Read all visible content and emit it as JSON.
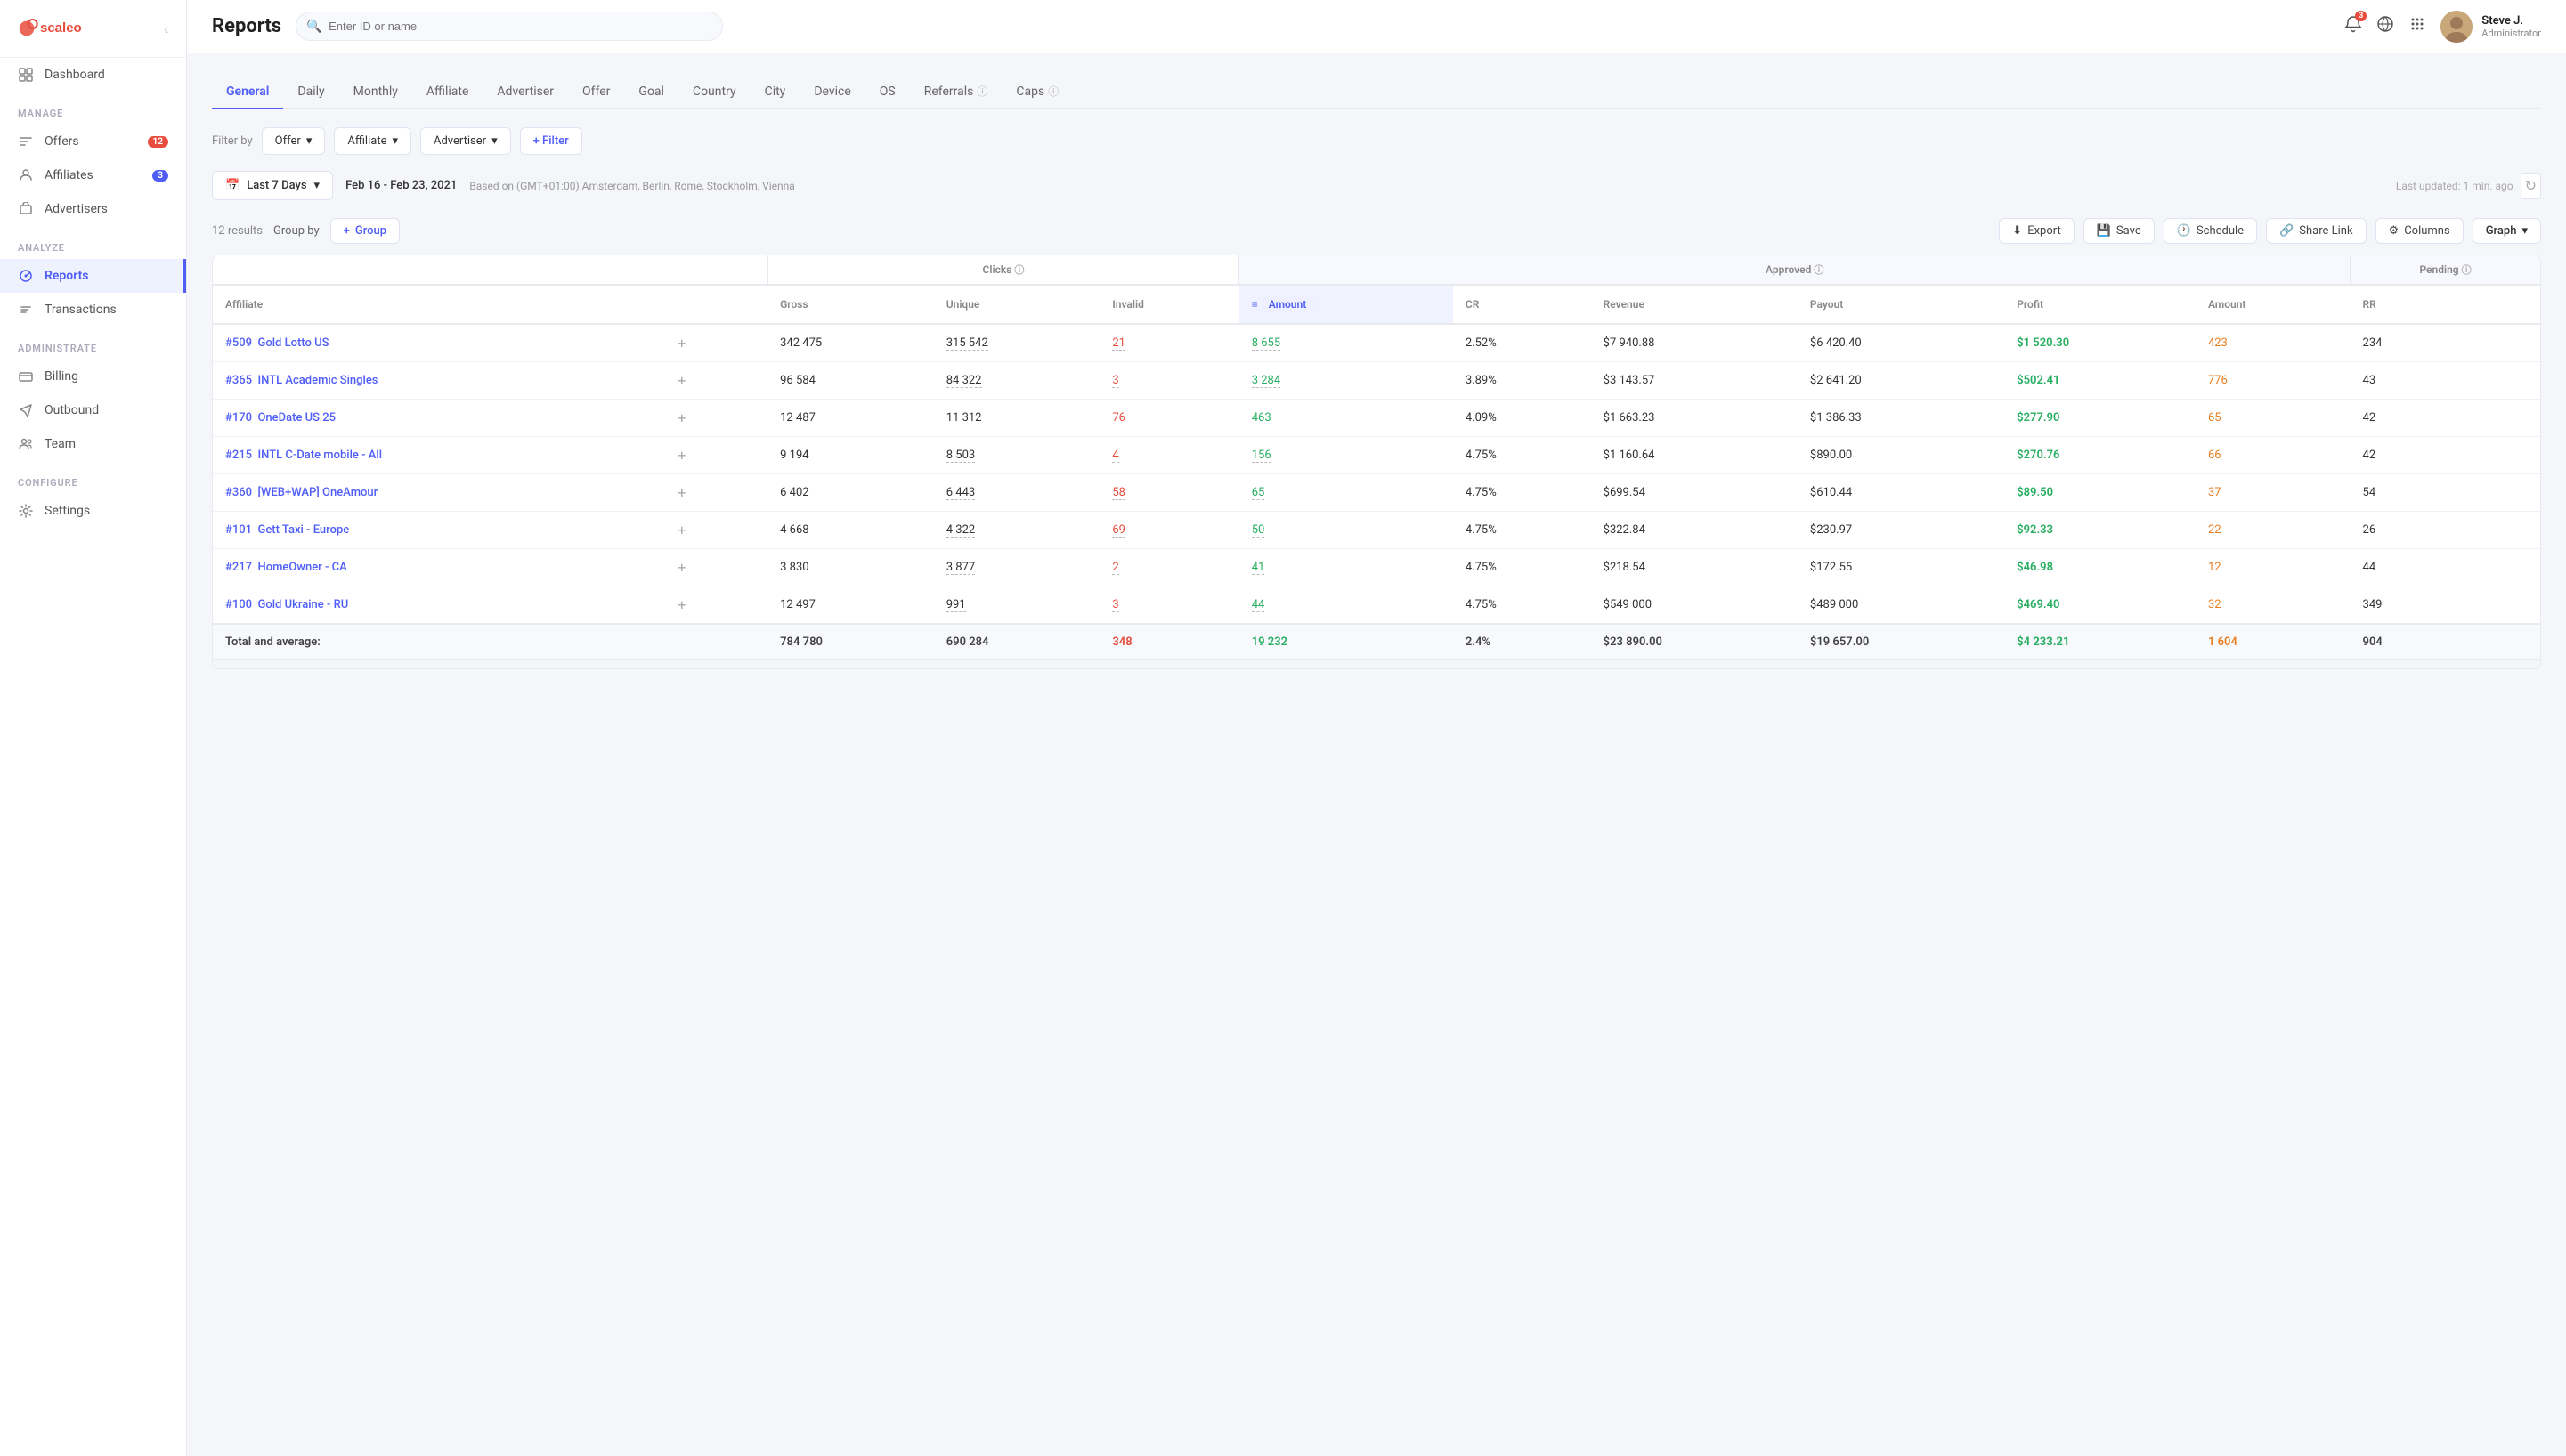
{
  "app": {
    "logo_text": "scaleo"
  },
  "header": {
    "title": "Reports",
    "search_placeholder": "Enter ID or name",
    "user": {
      "name": "Steve J.",
      "role": "Administrator"
    },
    "notifications_count": "3"
  },
  "sidebar": {
    "back_icon": "‹",
    "sections": [
      {
        "label": "",
        "items": [
          {
            "id": "dashboard",
            "label": "Dashboard",
            "icon": "grid",
            "badge": null,
            "active": false
          }
        ]
      },
      {
        "label": "MANAGE",
        "items": [
          {
            "id": "offers",
            "label": "Offers",
            "icon": "tag",
            "badge": "12",
            "badge_color": "red",
            "active": false
          },
          {
            "id": "affiliates",
            "label": "Affiliates",
            "icon": "user",
            "badge": "3",
            "badge_color": "blue",
            "active": false
          },
          {
            "id": "advertisers",
            "label": "Advertisers",
            "icon": "briefcase",
            "badge": null,
            "active": false
          }
        ]
      },
      {
        "label": "ANALYZE",
        "items": [
          {
            "id": "reports",
            "label": "Reports",
            "icon": "chart",
            "badge": null,
            "active": true
          },
          {
            "id": "transactions",
            "label": "Transactions",
            "icon": "list",
            "badge": null,
            "active": false
          }
        ]
      },
      {
        "label": "ADMINISTRATE",
        "items": [
          {
            "id": "billing",
            "label": "Billing",
            "icon": "credit-card",
            "badge": null,
            "active": false
          },
          {
            "id": "outbound",
            "label": "Outbound",
            "icon": "send",
            "badge": null,
            "active": false
          },
          {
            "id": "team",
            "label": "Team",
            "icon": "users",
            "badge": null,
            "active": false
          }
        ]
      },
      {
        "label": "CONFIGURE",
        "items": [
          {
            "id": "settings",
            "label": "Settings",
            "icon": "gear",
            "badge": null,
            "active": false
          }
        ]
      }
    ]
  },
  "tabs": [
    {
      "id": "general",
      "label": "General",
      "active": true,
      "has_info": false
    },
    {
      "id": "daily",
      "label": "Daily",
      "active": false,
      "has_info": false
    },
    {
      "id": "monthly",
      "label": "Monthly",
      "active": false,
      "has_info": false
    },
    {
      "id": "affiliate",
      "label": "Affiliate",
      "active": false,
      "has_info": false
    },
    {
      "id": "advertiser",
      "label": "Advertiser",
      "active": false,
      "has_info": false
    },
    {
      "id": "offer",
      "label": "Offer",
      "active": false,
      "has_info": false
    },
    {
      "id": "goal",
      "label": "Goal",
      "active": false,
      "has_info": false
    },
    {
      "id": "country",
      "label": "Country",
      "active": false,
      "has_info": false
    },
    {
      "id": "city",
      "label": "City",
      "active": false,
      "has_info": false
    },
    {
      "id": "device",
      "label": "Device",
      "active": false,
      "has_info": false
    },
    {
      "id": "os",
      "label": "OS",
      "active": false,
      "has_info": false
    },
    {
      "id": "referrals",
      "label": "Referrals",
      "active": false,
      "has_info": true
    },
    {
      "id": "caps",
      "label": "Caps",
      "active": false,
      "has_info": true
    }
  ],
  "filters": {
    "label": "Filter by",
    "items": [
      {
        "id": "offer",
        "label": "Offer"
      },
      {
        "id": "affiliate",
        "label": "Affiliate"
      },
      {
        "id": "advertiser",
        "label": "Advertiser"
      }
    ],
    "add_label": "+ Filter"
  },
  "date": {
    "range_label": "Last 7 Days",
    "range_value": "Feb 16 - Feb 23, 2021",
    "timezone": "Based on (GMT+01:00) Amsterdam, Berlin, Rome, Stockholm, Vienna",
    "last_updated": "Last updated: 1 min. ago"
  },
  "table": {
    "results_count": "12 results",
    "group_by_label": "Group by",
    "group_btn_label": "+ Group",
    "toolbar_actions": [
      {
        "id": "export",
        "label": "Export",
        "icon": "download"
      },
      {
        "id": "save",
        "label": "Save",
        "icon": "save"
      },
      {
        "id": "schedule",
        "label": "Schedule",
        "icon": "clock"
      },
      {
        "id": "share_link",
        "label": "Share Link",
        "icon": "link"
      },
      {
        "id": "columns",
        "label": "Columns",
        "icon": "columns"
      }
    ],
    "graph_btn_label": "Graph",
    "col_groups": [
      {
        "id": "clicks",
        "label": "Clicks",
        "has_info": true,
        "colspan": 3
      },
      {
        "id": "approved",
        "label": "Approved",
        "has_info": true,
        "colspan": 6
      },
      {
        "id": "pending",
        "label": "Pending",
        "has_info": true,
        "colspan": 2
      }
    ],
    "columns": [
      {
        "id": "affiliate",
        "label": "Affiliate"
      },
      {
        "id": "gross",
        "label": "Gross"
      },
      {
        "id": "unique",
        "label": "Unique"
      },
      {
        "id": "invalid",
        "label": "Invalid"
      },
      {
        "id": "amount",
        "label": "Amount",
        "sort_active": true
      },
      {
        "id": "cr",
        "label": "CR"
      },
      {
        "id": "revenue",
        "label": "Revenue"
      },
      {
        "id": "payout",
        "label": "Payout"
      },
      {
        "id": "profit",
        "label": "Profit"
      },
      {
        "id": "pending_amount",
        "label": "Amount"
      },
      {
        "id": "rr",
        "label": "RR"
      }
    ],
    "rows": [
      {
        "id": "#509",
        "affiliate": "Gold Lotto US",
        "gross": "342 475",
        "unique": "315 542",
        "invalid": "21",
        "amount": "8 655",
        "cr": "2.52%",
        "revenue": "$7 940.88",
        "payout": "$6 420.40",
        "profit": "$1 520.30",
        "pending_amount": "423",
        "rr": "234",
        "invalid_color": "red",
        "amount_color": "green",
        "pending_color": "orange"
      },
      {
        "id": "#365",
        "affiliate": "INTL Academic Singles",
        "gross": "96 584",
        "unique": "84 322",
        "invalid": "3",
        "amount": "3 284",
        "cr": "3.89%",
        "revenue": "$3 143.57",
        "payout": "$2 641.20",
        "profit": "$502.41",
        "pending_amount": "776",
        "rr": "43",
        "invalid_color": "red",
        "amount_color": "green",
        "pending_color": "orange"
      },
      {
        "id": "#170",
        "affiliate": "OneDate US 25",
        "gross": "12 487",
        "unique": "11 312",
        "invalid": "76",
        "amount": "463",
        "cr": "4.09%",
        "revenue": "$1 663.23",
        "payout": "$1 386.33",
        "profit": "$277.90",
        "pending_amount": "65",
        "rr": "42",
        "invalid_color": "red",
        "amount_color": "green",
        "pending_color": "orange"
      },
      {
        "id": "#215",
        "affiliate": "INTL C-Date mobile - All",
        "gross": "9 194",
        "unique": "8 503",
        "invalid": "4",
        "amount": "156",
        "cr": "4.75%",
        "revenue": "$1 160.64",
        "payout": "$890.00",
        "profit": "$270.76",
        "pending_amount": "66",
        "rr": "42",
        "invalid_color": "red",
        "amount_color": "green",
        "pending_color": "orange"
      },
      {
        "id": "#360",
        "affiliate": "[WEB+WAP] OneAmour",
        "gross": "6 402",
        "unique": "6 443",
        "invalid": "58",
        "amount": "65",
        "cr": "4.75%",
        "revenue": "$699.54",
        "payout": "$610.44",
        "profit": "$89.50",
        "pending_amount": "37",
        "rr": "54",
        "invalid_color": "red",
        "amount_color": "green",
        "pending_color": "orange"
      },
      {
        "id": "#101",
        "affiliate": "Gett Taxi - Europe",
        "gross": "4 668",
        "unique": "4 322",
        "invalid": "69",
        "amount": "50",
        "cr": "4.75%",
        "revenue": "$322.84",
        "payout": "$230.97",
        "profit": "$92.33",
        "pending_amount": "22",
        "rr": "26",
        "invalid_color": "red",
        "amount_color": "green",
        "pending_color": "orange"
      },
      {
        "id": "#217",
        "affiliate": "HomeOwner - CA",
        "gross": "3 830",
        "unique": "3 877",
        "invalid": "2",
        "amount": "41",
        "cr": "4.75%",
        "revenue": "$218.54",
        "payout": "$172.55",
        "profit": "$46.98",
        "pending_amount": "12",
        "rr": "44",
        "invalid_color": "red",
        "amount_color": "green",
        "pending_color": "orange"
      },
      {
        "id": "#100",
        "affiliate": "Gold Ukraine - RU",
        "gross": "12 497",
        "unique": "991",
        "invalid": "3",
        "amount": "44",
        "cr": "4.75%",
        "revenue": "$549 000",
        "payout": "$489 000",
        "profit": "$469.40",
        "pending_amount": "32",
        "rr": "349",
        "invalid_color": "red",
        "amount_color": "green",
        "pending_color": "orange"
      }
    ],
    "totals": {
      "label": "Total and average:",
      "gross": "784 780",
      "unique": "690 284",
      "invalid": "348",
      "amount": "19 232",
      "cr": "2.4%",
      "revenue": "$23 890.00",
      "payout": "$19 657.00",
      "profit": "$4 233.21",
      "pending_amount": "1 604",
      "rr": "904"
    }
  }
}
